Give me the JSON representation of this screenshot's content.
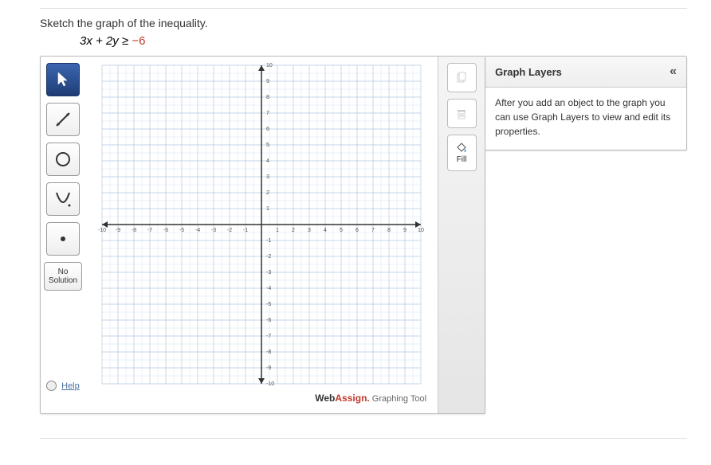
{
  "prompt": "Sketch the graph of the inequality.",
  "equation": {
    "lhs_num1": "3",
    "var1": "x",
    "plus": " + ",
    "lhs_num2": "2",
    "var2": "y",
    "rel": " ≥ ",
    "rhs": "−6"
  },
  "tools": {
    "pointer_name": "pointer-tool",
    "line_name": "line-tool",
    "circle_name": "circle-tool",
    "parabola_name": "parabola-tool",
    "point_name": "point-tool",
    "no_solution_line1": "No",
    "no_solution_line2": "Solution"
  },
  "help_text": "Help",
  "right_tools": {
    "copy_name": "copy-button",
    "trash_name": "delete-button",
    "fill_label": "Fill"
  },
  "branding": {
    "web": "Web",
    "assign": "Assign.",
    "tool": " Graphing Tool"
  },
  "layers": {
    "title": "Graph Layers",
    "body": "After you add an object to the graph you can use Graph Layers to view and edit its properties."
  },
  "chart_data": {
    "type": "scatter",
    "title": "",
    "xlabel": "",
    "ylabel": "",
    "xlim": [
      -10,
      10
    ],
    "ylim": [
      -10,
      10
    ],
    "xticks": [
      -10,
      -9,
      -8,
      -7,
      -6,
      -5,
      -4,
      -3,
      -2,
      -1,
      1,
      2,
      3,
      4,
      5,
      6,
      7,
      8,
      9,
      10
    ],
    "yticks": [
      -10,
      -9,
      -8,
      -7,
      -6,
      -5,
      -4,
      -3,
      -2,
      -1,
      1,
      2,
      3,
      4,
      5,
      6,
      7,
      8,
      9,
      10
    ],
    "series": [],
    "categories": [],
    "grid": true
  }
}
